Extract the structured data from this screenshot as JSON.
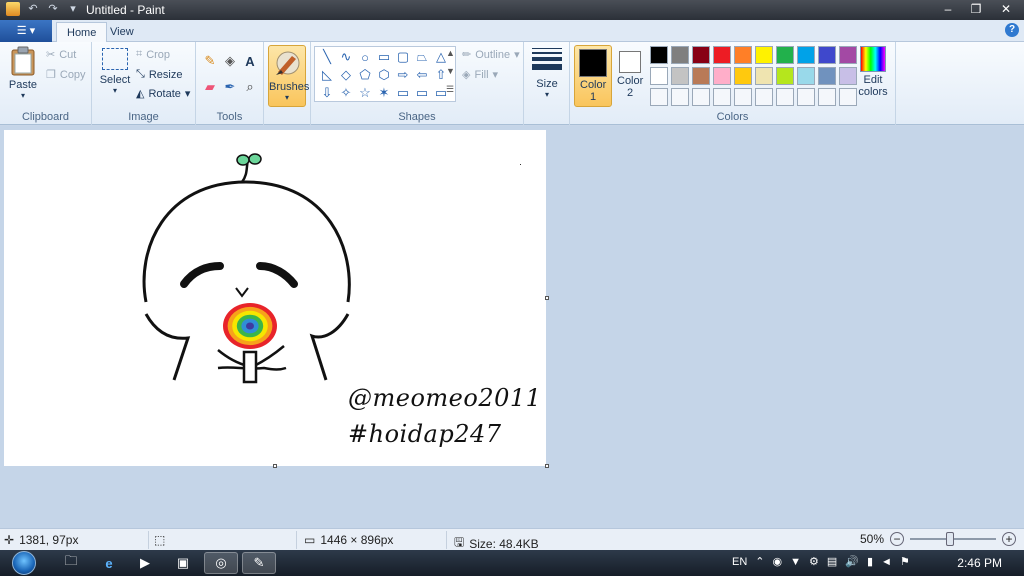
{
  "window": {
    "title": "Untitled - Paint",
    "qa_undo_icon": "undo-icon",
    "qa_redo_icon": "redo-icon",
    "qa_menu_icon": "chevron-down-icon",
    "minimize": "–",
    "maximize": "❐",
    "close": "✕"
  },
  "tabs": {
    "file_label": "☰ ▾",
    "items": [
      {
        "label": "Home",
        "active": true
      },
      {
        "label": "View",
        "active": false
      }
    ],
    "help": "?"
  },
  "ribbon": {
    "clipboard": {
      "label": "Clipboard",
      "paste": "Paste",
      "cut": "Cut",
      "copy": "Copy"
    },
    "image": {
      "label": "Image",
      "select": "Select",
      "crop": "Crop",
      "resize": "Resize",
      "rotate": "Rotate"
    },
    "tools": {
      "label": "Tools",
      "icons": [
        "pencil-icon",
        "fill-icon",
        "text-icon",
        "eraser-icon",
        "color-picker-icon",
        "magnifier-icon"
      ]
    },
    "brushes": {
      "label": "Brushes"
    },
    "shapes": {
      "label": "Shapes",
      "outline": "Outline",
      "fill": "Fill",
      "glyphs": [
        "╲",
        "∿",
        "○",
        "▭",
        "▢",
        "⏢",
        "△",
        "◺",
        "◇",
        "⬠",
        "⬡",
        "⇨",
        "⇦",
        "⇧",
        "⇩",
        "✧",
        "☆",
        "✶",
        "▭",
        "▭",
        "▭"
      ]
    },
    "size": {
      "label": "Size"
    },
    "colors": {
      "label": "Colors",
      "color1_label": "Color 1",
      "color1_value": "#000000",
      "color2_label": "Color 2",
      "color2_value": "#ffffff",
      "edit_colors": "Edit colors",
      "palette": [
        "#000000",
        "#7f7f7f",
        "#880015",
        "#ed1c24",
        "#ff7f27",
        "#fff200",
        "#22b14c",
        "#00a2e8",
        "#3f48cc",
        "#a349a4",
        "#ffffff",
        "#c3c3c3",
        "#b97a57",
        "#ffaec9",
        "#ffc90e",
        "#efe4b0",
        "#b5e61d",
        "#99d9ea",
        "#7092be",
        "#c8bfe7",
        "#f4f7fb",
        "#f4f7fb",
        "#f4f7fb",
        "#f4f7fb",
        "#f4f7fb",
        "#f4f7fb",
        "#f4f7fb",
        "#f4f7fb",
        "#f4f7fb",
        "#f4f7fb"
      ]
    }
  },
  "canvas": {
    "signature_line1": "@meomeo2011",
    "signature_line2": "#hoidap247",
    "lollipop_colors": [
      "#e8242a",
      "#f7a21b",
      "#f6e600",
      "#3bb54a",
      "#2f8fd7",
      "#3f3aa0"
    ]
  },
  "status": {
    "cursor_pos": "1381, 97px",
    "image_dims": "1446 × 896px",
    "size": "Size: 48.4KB",
    "zoom": "50%"
  },
  "taskbar": {
    "lang": "EN",
    "time": "2:46 PM",
    "icons": [
      "start-orb-icon",
      "folder-icon",
      "internet-explorer-icon",
      "media-player-icon",
      "video-icon",
      "browser-icon",
      "paint-icon"
    ]
  }
}
